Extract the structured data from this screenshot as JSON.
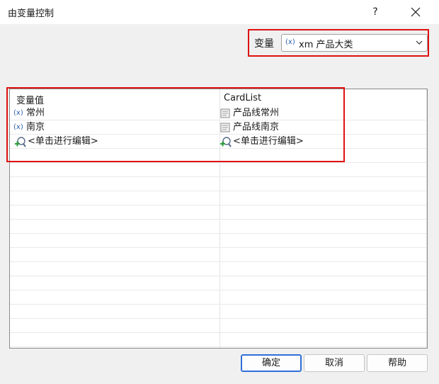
{
  "window": {
    "title": "由变量控制",
    "help_glyph": "?"
  },
  "variable": {
    "label": "变量",
    "icon_text": "(x)",
    "selected": "xm 产品大类"
  },
  "grid": {
    "columns": [
      "变量值",
      "CardList"
    ],
    "rows": [
      {
        "value_icon": "(x)",
        "value": "常州",
        "card": "产品线常州"
      },
      {
        "value_icon": "(x)",
        "value": "南京",
        "card": "产品线南京"
      },
      {
        "value": "<单击进行编辑>",
        "card": "<单击进行编辑>"
      }
    ]
  },
  "buttons": {
    "ok": "确定",
    "cancel": "取消",
    "help": "帮助"
  },
  "colors": {
    "highlight": "#e01010",
    "accent": "#2e6fd6",
    "variable_icon": "#2a5fb0"
  }
}
